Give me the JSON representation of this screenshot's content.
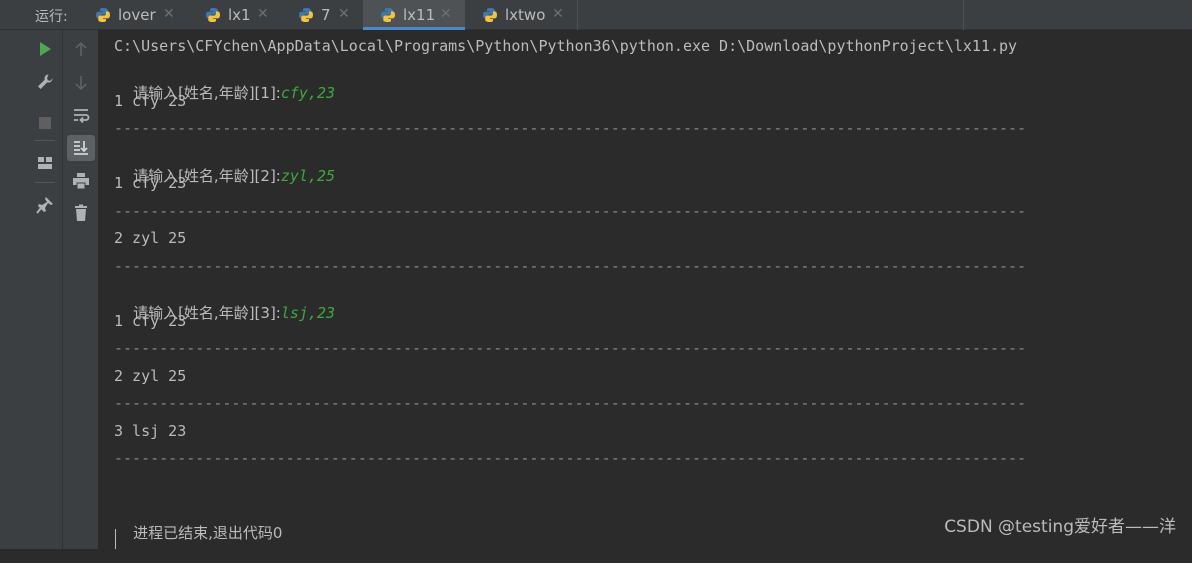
{
  "run_label": "运行:",
  "tabs": [
    {
      "label": "lover",
      "active": false
    },
    {
      "label": "lx1",
      "active": false
    },
    {
      "label": "7",
      "active": false
    },
    {
      "label": "lx11",
      "active": true
    },
    {
      "label": "lxtwo",
      "active": false
    }
  ],
  "toolbar": {
    "left": [
      "run-icon",
      "wrench-icon",
      "stop-icon",
      "layout-icon",
      "pin-icon"
    ],
    "right": [
      "arrow-up-icon",
      "arrow-down-icon",
      "soft-wrap-icon",
      "scroll-to-end-icon",
      "print-icon",
      "trash-icon"
    ]
  },
  "console": {
    "command": "C:\\Users\\CFYchen\\AppData\\Local\\Programs\\Python\\Python36\\python.exe D:\\Download\\pythonProject\\lx11.py",
    "prompt1": "请输入[姓名,年龄][1]:",
    "input1": "cfy,23",
    "prompt2": "请输入[姓名,年龄][2]:",
    "input2": "zyl,25",
    "prompt3": "请输入[姓名,年龄][3]:",
    "input3": "lsj,23",
    "row_cfy": "1 cfy 23",
    "row_zyl": "2 zyl 25",
    "row_lsj": "3 lsj 23",
    "separator": "-----------------------------------------------------------------------------------------------------",
    "exit_message": "进程已结束,退出代码0"
  },
  "watermark": "CSDN @testing爱好者——洋",
  "colors": {
    "background": "#2b2b2b",
    "panel": "#3c3f41",
    "input_echo": "#3da93d",
    "run_icon": "#4fa84f",
    "active_tab_underline": "#4a88c7"
  }
}
